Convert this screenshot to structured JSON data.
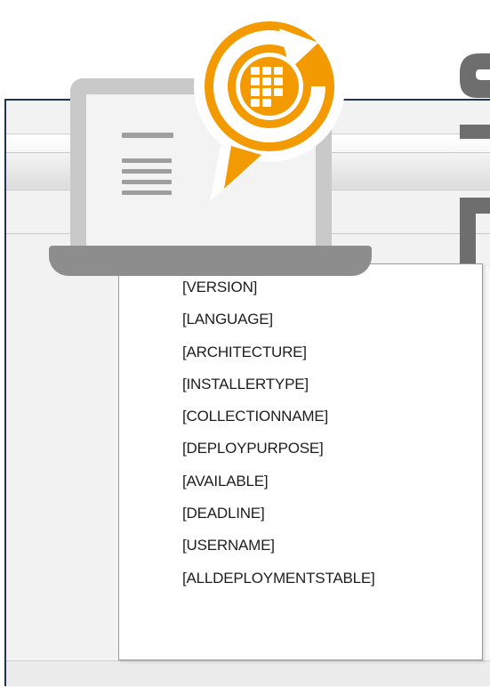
{
  "colors": {
    "badge_orange": "#f29a00",
    "frame_border": "#1f3553",
    "laptop_gray": "#8d8d8d",
    "logo_gray": "#6e6e6e"
  },
  "illustration": {
    "laptop_icon": "laptop-document-icon",
    "badge_icon": "refresh-apps-icon"
  },
  "popup": {
    "items": [
      "[VERSION]",
      "[LANGUAGE]",
      "[ARCHITECTURE]",
      "[INSTALLERTYPE]",
      "[COLLECTIONNAME]",
      "[DEPLOYPURPOSE]",
      "[AVAILABLE]",
      "[DEADLINE]",
      "[USERNAME]",
      "[ALLDEPLOYMENTSTABLE]"
    ]
  }
}
